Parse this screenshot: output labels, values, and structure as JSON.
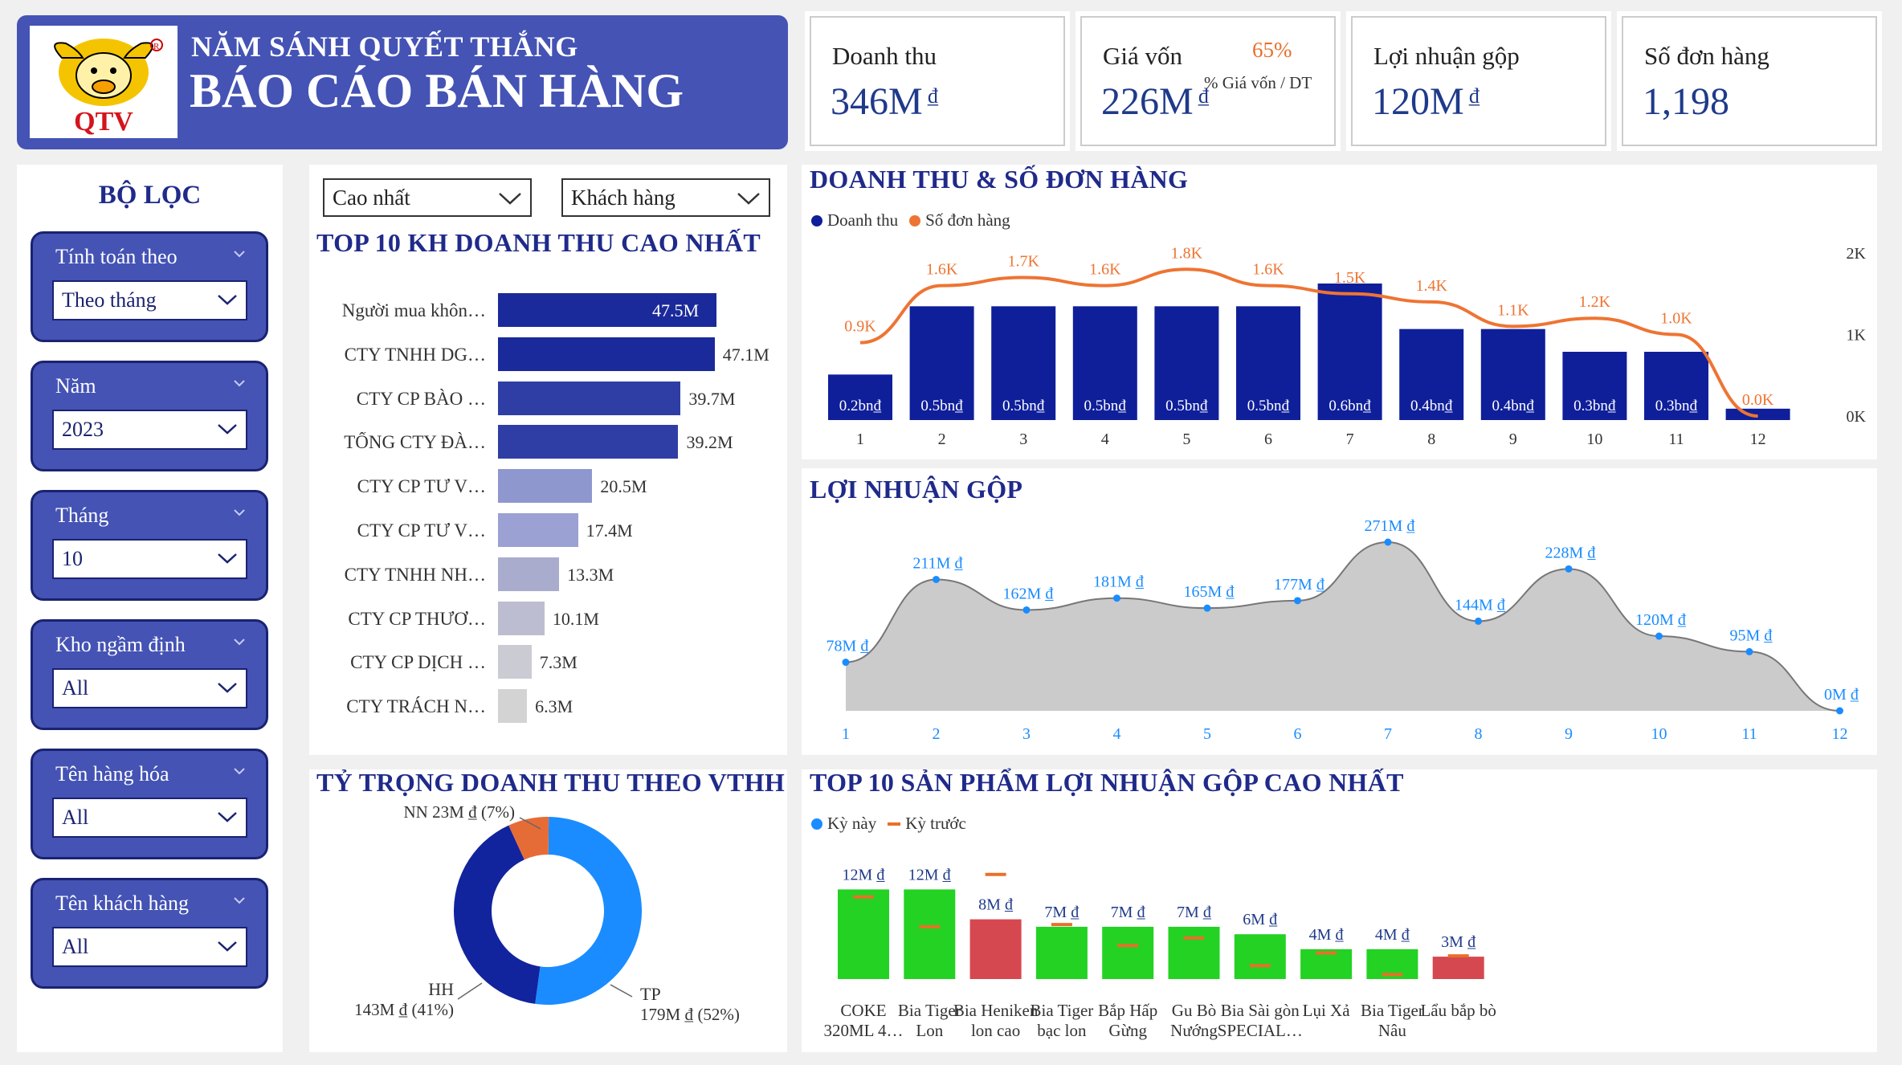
{
  "header": {
    "subtitle": "NĂM SÁNH QUYẾT THẮNG",
    "title": "BÁO CÁO BÁN HÀNG",
    "logo_text": "QTV"
  },
  "kpis": {
    "revenue": {
      "label": "Doanh thu",
      "value": "346M",
      "unit": "₫"
    },
    "cogs": {
      "label": "Giá vốn",
      "value": "226M",
      "unit": "₫",
      "ratio": "65%",
      "ratio_label": "% Giá vốn / DT"
    },
    "gross_profit": {
      "label": "Lợi nhuận gộp",
      "value": "120M",
      "unit": "₫"
    },
    "orders": {
      "label": "Số đơn hàng",
      "value": "1,198"
    }
  },
  "filters": {
    "title": "BỘ LỌC",
    "items": [
      {
        "label": "Tính toán theo",
        "value": "Theo tháng"
      },
      {
        "label": "Năm",
        "value": "2023"
      },
      {
        "label": "Tháng",
        "value": "10"
      },
      {
        "label": "Kho ngầm định",
        "value": "All"
      },
      {
        "label": "Tên hàng hóa",
        "value": "All"
      },
      {
        "label": "Tên khách hàng",
        "value": "All"
      }
    ]
  },
  "top_customers": {
    "title": "TOP 10 KH DOANH THU CAO NHẤT",
    "select_sort": "Cao nhất",
    "select_dim": "Khách hàng",
    "rows": [
      {
        "name": "Người mua khôn…",
        "value": 47.5,
        "label": "47.5M",
        "color": "#1a2a9a",
        "inside": true
      },
      {
        "name": "CTY TNHH DG…",
        "value": 47.1,
        "label": "47.1M",
        "color": "#1a2a9a"
      },
      {
        "name": "CTY CP BÀO …",
        "value": 39.7,
        "label": "39.7M",
        "color": "#2f3ea4"
      },
      {
        "name": "TỔNG CTY ĐÀ…",
        "value": 39.2,
        "label": "39.2M",
        "color": "#2f3ea4"
      },
      {
        "name": "CTY CP TƯ V…",
        "value": 20.5,
        "label": "20.5M",
        "color": "#8f97cf"
      },
      {
        "name": "CTY CP TƯ V…",
        "value": 17.4,
        "label": "17.4M",
        "color": "#9ba1d2"
      },
      {
        "name": "CTY TNHH NH…",
        "value": 13.3,
        "label": "13.3M",
        "color": "#a9accc"
      },
      {
        "name": "CTY CP THƯƠ…",
        "value": 10.1,
        "label": "10.1M",
        "color": "#bcbdd0"
      },
      {
        "name": "CTY CP DỊCH …",
        "value": 7.3,
        "label": "7.3M",
        "color": "#cbcbd3"
      },
      {
        "name": "CTY TRÁCH N…",
        "value": 6.3,
        "label": "6.3M",
        "color": "#d3d3d3"
      }
    ]
  },
  "chart_data": [
    {
      "type": "bar",
      "title": "DOANH THU & SỐ ĐƠN HÀNG",
      "categories": [
        "1",
        "2",
        "3",
        "4",
        "5",
        "6",
        "7",
        "8",
        "9",
        "10",
        "11",
        "12"
      ],
      "series": [
        {
          "name": "Doanh thu",
          "color": "#0f1f9a",
          "values": [
            0.2,
            0.5,
            0.5,
            0.5,
            0.5,
            0.5,
            0.6,
            0.4,
            0.4,
            0.3,
            0.3,
            0.05
          ],
          "labels": [
            "0.2bn₫",
            "0.5bn₫",
            "0.5bn₫",
            "0.5bn₫",
            "0.5bn₫",
            "0.5bn₫",
            "0.6bn₫",
            "0.4bn₫",
            "0.4bn₫",
            "0.3bn₫",
            "0.3bn₫",
            ""
          ]
        },
        {
          "name": "Số đơn hàng",
          "color": "#ee7433",
          "type": "line",
          "values": [
            900,
            1600,
            1700,
            1600,
            1800,
            1600,
            1500,
            1400,
            1100,
            1200,
            1000,
            0
          ],
          "labels": [
            "0.9K",
            "1.6K",
            "1.7K",
            "1.6K",
            "1.8K",
            "1.6K",
            "1.5K",
            "1.4K",
            "1.1K",
            "1.2K",
            "1.0K",
            "0.0K"
          ]
        }
      ],
      "y2_ticks": [
        "0K",
        "1K",
        "2K"
      ],
      "y2lim": [
        0,
        2000
      ]
    },
    {
      "type": "area",
      "title": "LỢI NHUẬN GỘP",
      "x": [
        "1",
        "2",
        "3",
        "4",
        "5",
        "6",
        "7",
        "8",
        "9",
        "10",
        "11",
        "12"
      ],
      "values": [
        78,
        211,
        162,
        181,
        165,
        177,
        271,
        144,
        228,
        120,
        95,
        0
      ],
      "labels": [
        "78M ₫",
        "211M ₫",
        "162M ₫",
        "181M ₫",
        "165M ₫",
        "177M ₫",
        "271M ₫",
        "144M ₫",
        "228M ₫",
        "120M ₫",
        "95M ₫",
        "0M ₫"
      ]
    },
    {
      "type": "pie",
      "title": "TỶ TRỌNG DOANH THU THEO VTHH",
      "slices": [
        {
          "name": "TP",
          "value": 52,
          "label": "179M ₫ (52%)",
          "color": "#1a8cff"
        },
        {
          "name": "HH",
          "value": 41,
          "label": "143M ₫ (41%)",
          "color": "#12239e"
        },
        {
          "name": "NN",
          "value": 7,
          "label": "NN 23M ₫ (7%)",
          "color": "#e66c37"
        }
      ]
    },
    {
      "type": "bar",
      "title": "TOP 10 SẢN PHẨM LỢI NHUẬN GỘP CAO NHẤT",
      "legend": [
        "Kỳ này",
        "Kỳ trước"
      ],
      "categories": [
        [
          "COKE",
          "320ML 4…"
        ],
        [
          "Bia Tiger",
          "Lon"
        ],
        [
          "Bia Heniken",
          "lon cao"
        ],
        [
          "Bia Tiger",
          "bạc lon"
        ],
        [
          "Bắp Hấp",
          "Gừng"
        ],
        [
          "Gu Bò",
          "Nướng"
        ],
        [
          "Bia Sài gòn",
          "SPECIAL…"
        ],
        [
          "Lụi Xả"
        ],
        [
          "Bia Tiger",
          "Nâu"
        ],
        [
          "Lẩu bắp bò"
        ]
      ],
      "series": [
        {
          "name": "Kỳ này",
          "values": [
            12,
            12,
            8,
            7,
            7,
            7,
            6,
            4,
            4,
            3
          ],
          "labels": [
            "12M ₫",
            "12M ₫",
            "8M ₫",
            "7M ₫",
            "7M ₫",
            "7M ₫",
            "6M ₫",
            "4M ₫",
            "4M ₫",
            "3M ₫"
          ],
          "colors": [
            "#23d223",
            "#23d223",
            "#d6484f",
            "#23d223",
            "#23d223",
            "#23d223",
            "#23d223",
            "#23d223",
            "#23d223",
            "#d6484f"
          ]
        },
        {
          "name": "Kỳ trước",
          "values": [
            11,
            7,
            14,
            7.3,
            4.5,
            5.5,
            1.8,
            3.5,
            0.6,
            3.1
          ],
          "color": "#e8702a"
        }
      ]
    }
  ],
  "legend_colors": {
    "kynay": "#1a8cff",
    "kytruoc": "#e8702a"
  }
}
